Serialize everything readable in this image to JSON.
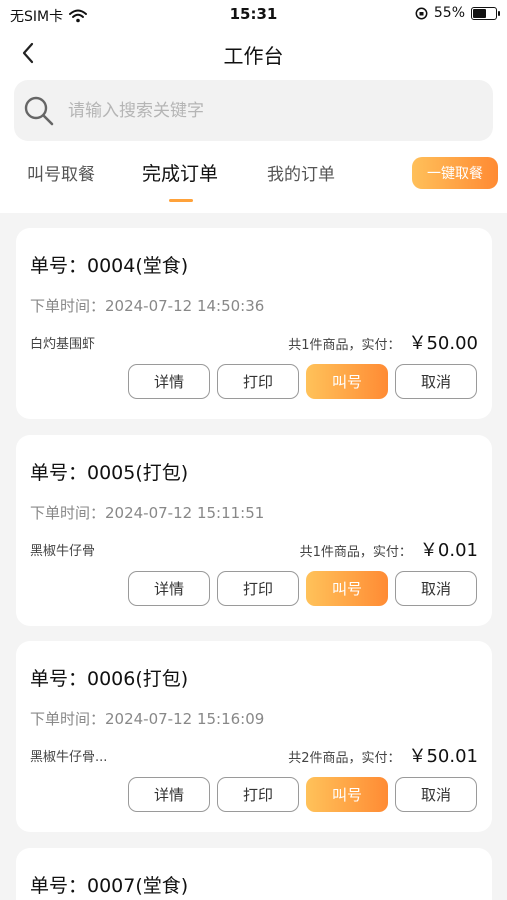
{
  "status_bar": {
    "carrier": "无SIM卡",
    "time": "15:31",
    "battery": "55%",
    "battery_level": 0.55
  },
  "navbar": {
    "title": "工作台"
  },
  "search": {
    "placeholder": "请输入搜索关键字"
  },
  "tabs": [
    {
      "label": "叫号取餐"
    },
    {
      "label": "完成订单",
      "active": true
    },
    {
      "label": "我的订单"
    }
  ],
  "onekey_button": "一键取餐",
  "actions": {
    "detail": "详情",
    "print": "打印",
    "call": "叫号",
    "cancel": "取消"
  },
  "orders": [
    {
      "number": "单号：0004(堂食)",
      "time": "下单时间：2024-07-12 14:50:36",
      "items": "白灼基围虾",
      "summary": "共1件商品，实付：",
      "amount": "￥50.00"
    },
    {
      "number": "单号：0005(打包)",
      "time": "下单时间：2024-07-12 15:11:51",
      "items": "黑椒牛仔骨",
      "summary": "共1件商品，实付：",
      "amount": "￥0.01"
    },
    {
      "number": "单号：0006(打包)",
      "time": "下单时间：2024-07-12 15:16:09",
      "items": "黑椒牛仔骨...",
      "summary": "共2件商品，实付：",
      "amount": "￥50.01"
    },
    {
      "number": "单号：0007(堂食)"
    }
  ],
  "colors": {
    "accent_start": "#ffc05a",
    "accent_end": "#ff8a33",
    "underline": "#ffa23a"
  },
  "icons": [
    "back-chevron-icon",
    "search-icon",
    "wifi-icon",
    "orientation-lock-icon",
    "battery-icon"
  ]
}
